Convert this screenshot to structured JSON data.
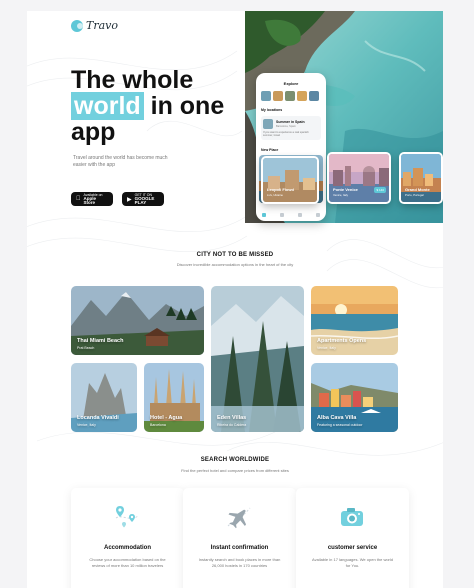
{
  "brand": {
    "name": "Travo"
  },
  "hero": {
    "title_line1": "The whole",
    "title_highlight": "world",
    "title_line2_rest": "in one",
    "title_line3": "app",
    "subtitle": "Travel around the world has become much easier with the app",
    "app_store": {
      "small": "Available on",
      "big": "Apple Store"
    },
    "google_play": {
      "small": "GET IT ON",
      "big": "GOOGLE PLAY"
    }
  },
  "phone": {
    "title": "Explore",
    "my_locations_label": "My locations",
    "card_title": "Summer in Spain",
    "card_sub": "Barcelona, Spain",
    "card_desc": "If you want to experience a real spanish summer, travel",
    "new_place_label": "New Place"
  },
  "floating_cards": [
    {
      "name": "Leopoli Flowd",
      "location": "Lviv, Ukraine"
    },
    {
      "name": "Ponte Venice",
      "location": "Venice, Italy",
      "price": "$ 140"
    },
    {
      "name": "Grand Monte",
      "location": "Porto, Portugal"
    }
  ],
  "section_city": {
    "title": "CITY NOT TO BE MISSED",
    "subtitle": "Discover incredible accommodation options in the heart of the city"
  },
  "gallery": [
    {
      "name": "Thai Miami Beach",
      "location": "Prat Beach"
    },
    {
      "name": "Eden Villas",
      "location": "Ribeira do Caldera"
    },
    {
      "name": "Apartments Opens",
      "location": "Venice, Italy"
    },
    {
      "name": "Locanda Vivaldi",
      "location": "Venice, Italy"
    },
    {
      "name": "Hotel - Agua",
      "location": "Barcelona"
    },
    {
      "name": "Alba Cava Villa",
      "location": "Featuring a seasonal outdoor"
    }
  ],
  "section_search": {
    "title": "SEARCH WORLDWIDE",
    "subtitle": "Find the perfect hotel and compare prices from different sites"
  },
  "features": [
    {
      "title": "Accommodation",
      "desc": "Choose your accommodation based on the reviews of more than 10 million travelers",
      "icon": "map-pin-icon"
    },
    {
      "title": "Instant confirmation",
      "desc": "Instantly search and book places in more than 26,000 hostels in 170 countries",
      "icon": "airplane-icon"
    },
    {
      "title": "customer service",
      "desc": "Available in 17 languages. We open the world for You.",
      "icon": "camera-icon"
    }
  ],
  "colors": {
    "accent": "#72d0de",
    "text": "#111111",
    "muted": "#777777"
  }
}
